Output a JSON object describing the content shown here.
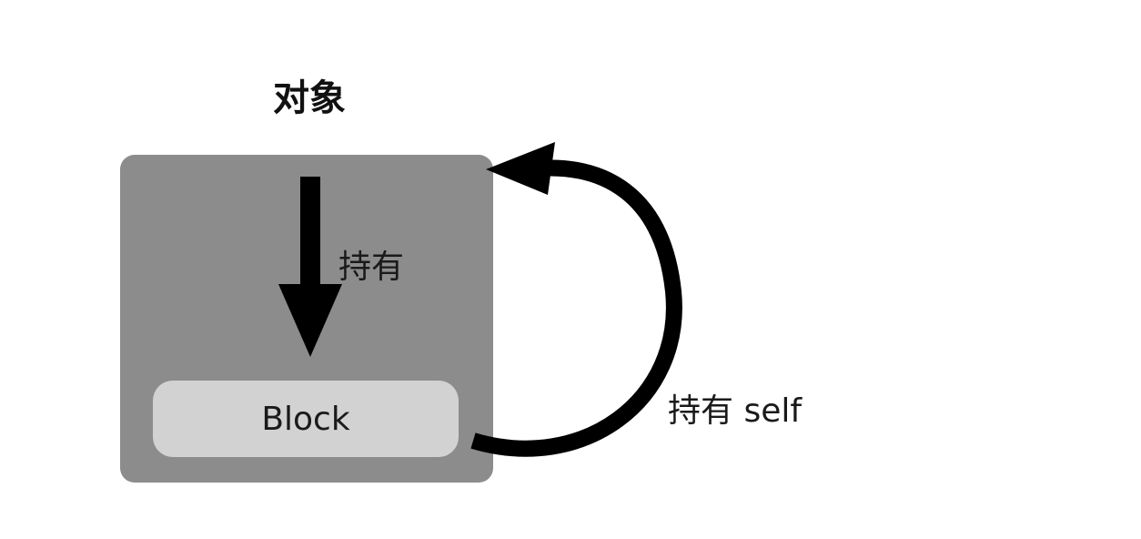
{
  "diagram": {
    "object_label": "对象",
    "block_label": "Block",
    "hold_label": "持有",
    "hold_self_label": "持有 self"
  },
  "colors": {
    "object_fill": "#8c8c8c",
    "block_fill": "#d2d2d2",
    "arrow": "#000000",
    "text": "#1a1a1a"
  }
}
